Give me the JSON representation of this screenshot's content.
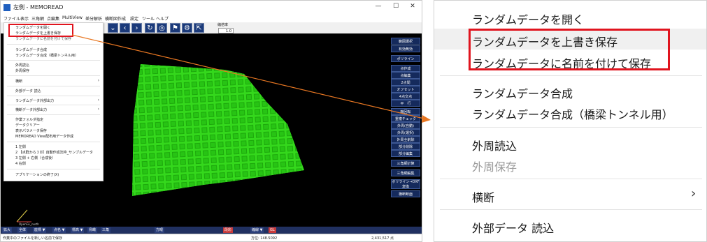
{
  "window": {
    "title": "左側 - MEMOREAD",
    "minimize": "—",
    "maximize": "☐",
    "close": "✕"
  },
  "menubar": [
    "ファイル",
    "表示",
    "三角網",
    "点編集",
    "MultiView",
    "差分解析",
    "横断図作成",
    "設定",
    "ツール",
    "ヘルプ"
  ],
  "toolbar": {
    "buttons": [
      "chevron-down-icon",
      "chevron-left-icon",
      "chevron-right-icon",
      "rotate-icon",
      "target-icon",
      "flag-icon",
      "settings-icon",
      "export-icon"
    ],
    "zoom_label": "縮倍率",
    "zoom_value": "1.0"
  },
  "sidebar": [
    "範囲選択",
    "有効無効",
    "ポリライン",
    "点作成",
    "点編集",
    "2点間",
    "オフセット",
    "4点交点",
    "平　行",
    "軸回転",
    "重複チェック",
    "外周(自動)",
    "外周(選択)",
    "外周全削除",
    "部分削除",
    "部分編集",
    "三角網計算",
    "三角網編集",
    "ポリライン→DXF変換",
    "横断断面"
  ],
  "bottombar": [
    "拡大",
    "全体",
    "座標 ▼",
    "点名 ▼",
    "標高 ▼",
    "鳥瞰",
    "三角",
    "方眼",
    "段彩",
    "縮線 ▼",
    "GL"
  ],
  "statusbar": {
    "message": "作業中のファイルを新しい名前で保存",
    "position": "方位: 148.5092",
    "count": "2,431,517 点"
  },
  "axis_label": "OpenGL_north",
  "file_menu": {
    "items": [
      {
        "label": "ランダムデータを開く"
      },
      {
        "label": "ランダムデータを上書き保存"
      },
      {
        "label": "ランダムデータに名前を付けて保存"
      },
      {
        "label": "ランダムデータ合成"
      },
      {
        "label": "ランダムデータ合成（橋梁トンネル用）"
      },
      {
        "label": "外周読込"
      },
      {
        "label": "外周保存",
        "disabled": true
      },
      {
        "label": "横断",
        "submenu": true
      },
      {
        "label": "外部データ 読込"
      },
      {
        "label": "ランダムデータ外部出力",
        "submenu": true
      },
      {
        "label": "横断データ外部出力",
        "submenu": true
      },
      {
        "label": "作業フォルダ指定"
      },
      {
        "label": "データクリアー"
      },
      {
        "label": "表示パラメータ保存"
      },
      {
        "label": "MEMOREAD View配布用データ作成"
      },
      {
        "label": "1 左側"
      },
      {
        "label": "2 【点群から３D】自動作成法枠_サンプルデータ"
      },
      {
        "label": "3 左側 + 右側（合成後）"
      },
      {
        "label": "4 右側"
      },
      {
        "label": "アプリケーションの終了(X)"
      }
    ],
    "submenu_arrow": "›"
  },
  "zoom_menu": {
    "items": [
      {
        "label": "ランダムデータを開く"
      },
      {
        "label": "ランダムデータを上書き保存"
      },
      {
        "label": "ランダムデータに名前を付けて保存"
      },
      {
        "label": "ランダムデータ合成"
      },
      {
        "label": "ランダムデータ合成（橋梁トンネル用）"
      },
      {
        "label": "外周読込"
      },
      {
        "label": "外周保存",
        "disabled": true
      },
      {
        "label": "横断",
        "submenu": true
      },
      {
        "label": "外部データ 読込"
      }
    ],
    "submenu_arrow": "›"
  },
  "colors": {
    "mesh": "#2fdc1a",
    "highlight_box": "#e0141e",
    "arrow": "#e87722",
    "toolbar_button": "#1b3a7a"
  }
}
